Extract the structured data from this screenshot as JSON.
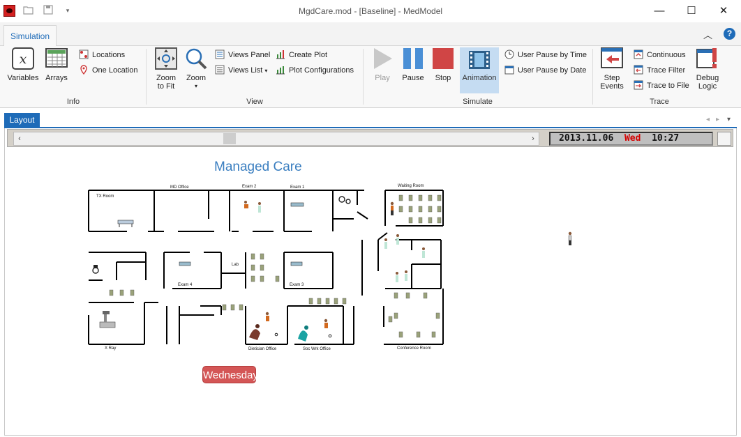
{
  "window": {
    "title": "MgdCare.mod - [Baseline] - MedModel",
    "minimize_glyph": "—",
    "maximize_glyph": "☐",
    "close_glyph": "✕"
  },
  "ribbon": {
    "tabs": [
      "Simulation"
    ],
    "collapse_glyph": "︿",
    "help_glyph": "?",
    "groups": {
      "info": {
        "label": "Info",
        "variables": "Variables",
        "arrays": "Arrays",
        "locations": "Locations",
        "one_location": "One Location"
      },
      "view": {
        "label": "View",
        "zoom_to_fit_1": "Zoom",
        "zoom_to_fit_2": "to Fit",
        "zoom": "Zoom",
        "views_panel": "Views Panel",
        "views_list": "Views List",
        "create_plot": "Create Plot",
        "plot_configurations": "Plot Configurations"
      },
      "simulate": {
        "label": "Simulate",
        "play": "Play",
        "pause": "Pause",
        "stop": "Stop",
        "animation": "Animation",
        "user_pause_time": "User Pause by Time",
        "user_pause_date": "User Pause by Date"
      },
      "trace": {
        "label": "Trace",
        "step_events_1": "Step",
        "step_events_2": "Events",
        "continuous": "Continuous",
        "trace_filter": "Trace Filter",
        "trace_to_file": "Trace to File",
        "debug_logic_1": "Debug",
        "debug_logic_2": "Logic"
      }
    }
  },
  "layout": {
    "tab_label": "Layout",
    "clock": {
      "date": "2013.11.06",
      "day": "Wed",
      "time": "10:27"
    },
    "map_title": "Managed Care",
    "day_badge": "Wednesday",
    "rooms": {
      "tx_room": "TX Room",
      "md_office": "MD Office",
      "exam2": "Exam 2",
      "exam1": "Exam 1",
      "waiting_room": "Waiting Room",
      "lab": "Lab",
      "exam4": "Exam 4",
      "exam3": "Exam 3",
      "x_ray": "X Ray",
      "dietician_office": "Dietician Office",
      "soc_wrk_office": "Soc Wrk Office",
      "conference_room": "Conference Room"
    }
  }
}
